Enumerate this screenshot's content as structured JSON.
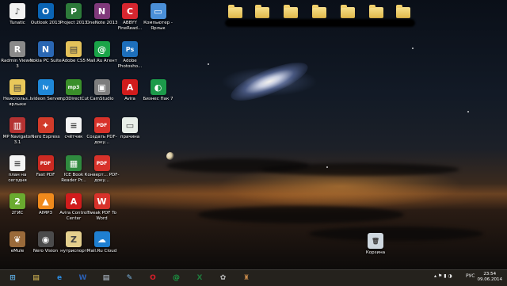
{
  "desktop_icons": [
    {
      "label": "Tunatic",
      "icon": "tunatic-icon",
      "color": "#f2f2f2",
      "glyph": "♪"
    },
    {
      "label": "Outlook 2013",
      "icon": "outlook-icon",
      "color": "#0a64b4",
      "glyph": "O"
    },
    {
      "label": "Project 2013",
      "icon": "project-icon",
      "color": "#2d7a3a",
      "glyph": "P"
    },
    {
      "label": "OneNote 2013",
      "icon": "onenote-icon",
      "color": "#80397b",
      "glyph": "N"
    },
    {
      "label": "ABBYY FineRead...",
      "icon": "abbyy-icon",
      "color": "#d7262f",
      "glyph": "C"
    },
    {
      "label": "Компьютер - Ярлык",
      "icon": "computer-icon",
      "color": "#4a8fd8",
      "glyph": "▭"
    },
    {
      "label": "Radmin Viewer 3",
      "icon": "radmin-icon",
      "color": "#8a8a8a",
      "glyph": "R"
    },
    {
      "label": "Nokia PC Suite",
      "icon": "nokia-icon",
      "color": "#2a67b3",
      "glyph": "N"
    },
    {
      "label": "Adobe CS5",
      "icon": "adobe-cs5-icon",
      "color": "#e3c15a",
      "glyph": "▤"
    },
    {
      "label": "Mail.Ru Агент",
      "icon": "mailru-agent-icon",
      "color": "#1aa448",
      "glyph": "@"
    },
    {
      "label": "Adobe Photosho...",
      "icon": "photoshop-icon",
      "color": "#1d6fbb",
      "glyph": "Ps"
    },
    {
      "label": "Неиспольз... ярлыки",
      "icon": "folder-icon",
      "color": "#e9c85a",
      "glyph": "▤"
    },
    {
      "label": "Ivideon Server",
      "icon": "ivideon-icon",
      "color": "#1f88d8",
      "glyph": "iv"
    },
    {
      "label": "mp3DirectCut",
      "icon": "mp3directcut-icon",
      "color": "#3a8f2a",
      "glyph": "mp3"
    },
    {
      "label": "CamStudio",
      "icon": "camstudio-icon",
      "color": "#7d7d7d",
      "glyph": "▣"
    },
    {
      "label": "Avira",
      "icon": "avira-icon",
      "color": "#d11c1c",
      "glyph": "A"
    },
    {
      "label": "Бизнес Пак 7",
      "icon": "business-pack-icon",
      "color": "#1c9a4a",
      "glyph": "◐"
    },
    {
      "label": "MP Navigator 3.1",
      "icon": "mp-navigator-icon",
      "color": "#b43232",
      "glyph": "▥"
    },
    {
      "label": "Nero Express",
      "icon": "nero-express-icon",
      "color": "#d23b2a",
      "glyph": "✦"
    },
    {
      "label": "счётчик",
      "icon": "document-icon",
      "color": "#f4f4f4",
      "glyph": "≡"
    },
    {
      "label": "Создать PDF-доку...",
      "icon": "create-pdf-icon",
      "color": "#d8322a",
      "glyph": "PDF"
    },
    {
      "label": "прачина",
      "icon": "image-file-icon",
      "color": "#e9efe9",
      "glyph": "▭"
    },
    {
      "label": "план на сегодня",
      "icon": "document-icon",
      "color": "#f4f4f4",
      "glyph": "≡"
    },
    {
      "label": "Fast PDF",
      "icon": "fast-pdf-icon",
      "color": "#cc2a22",
      "glyph": "PDF"
    },
    {
      "label": "ICE Book Reader Pr...",
      "icon": "ice-book-reader-icon",
      "color": "#2f8a3e",
      "glyph": "▦"
    },
    {
      "label": "Конверт... PDF-доку...",
      "icon": "convert-pdf-icon",
      "color": "#d8322a",
      "glyph": "PDF"
    },
    {
      "label": "2ГИС",
      "icon": "2gis-icon",
      "color": "#6aab2f",
      "glyph": "2"
    },
    {
      "label": "AIMP3",
      "icon": "aimp3-icon",
      "color": "#f08a1c",
      "glyph": "▲"
    },
    {
      "label": "Avira Control Center",
      "icon": "avira-control-icon",
      "color": "#d11c1c",
      "glyph": "A"
    },
    {
      "label": "Tweak PDF To Word",
      "icon": "tweak-pdf-icon",
      "color": "#d8322a",
      "glyph": "W"
    },
    {
      "label": "eMule",
      "icon": "emule-icon",
      "color": "#9a6a3a",
      "glyph": "❦"
    },
    {
      "label": "Nero Vision",
      "icon": "nero-vision-icon",
      "color": "#4b4b4b",
      "glyph": "◉"
    },
    {
      "label": "нутриспорт",
      "icon": "zip-folder-icon",
      "color": "#e4cf8d",
      "glyph": "Z"
    },
    {
      "label": "Mail.Ru Cloud",
      "icon": "mailru-cloud-icon",
      "color": "#1f7fd0",
      "glyph": "☁"
    },
    {
      "label": "Корзина",
      "icon": "recycle-bin-icon",
      "color": "#cfd8df",
      "glyph": "🗑"
    }
  ],
  "top_folders_count_hint": "",
  "taskbar": {
    "items": [
      {
        "name": "start-button",
        "icon": "windows-icon",
        "glyph": "⊞"
      },
      {
        "name": "explorer-button",
        "icon": "folder-icon",
        "glyph": "▤"
      },
      {
        "name": "ie-button",
        "icon": "internet-explorer-icon",
        "glyph": "e"
      },
      {
        "name": "word-button",
        "icon": "word-icon",
        "glyph": "W"
      },
      {
        "name": "documents-button",
        "icon": "document-icon",
        "glyph": "▤"
      },
      {
        "name": "notes-button",
        "icon": "notepad-icon",
        "glyph": "✎"
      },
      {
        "name": "opera-button",
        "icon": "opera-icon",
        "glyph": "O"
      },
      {
        "name": "mailru-agent-button",
        "icon": "mailru-agent-icon",
        "glyph": "@"
      },
      {
        "name": "excel-button",
        "icon": "excel-icon",
        "glyph": "X"
      },
      {
        "name": "paint-button",
        "icon": "paint-icon",
        "glyph": "✿"
      },
      {
        "name": "app-button",
        "icon": "lamp-icon",
        "glyph": "♜"
      }
    ],
    "tray_lang": "РУС",
    "time": "23:54",
    "date": "09.06.2014"
  }
}
